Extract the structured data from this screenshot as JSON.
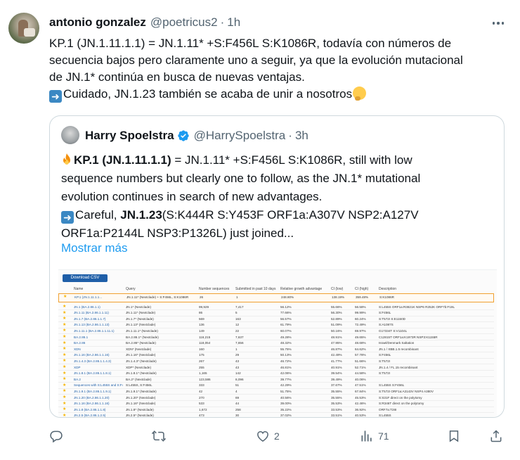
{
  "tweet": {
    "author_name": "antonio gonzalez",
    "author_handle": "@poetricus2",
    "time": "1h",
    "separator": "·",
    "lines": [
      "KP.1 (JN.1.11.1.1) = JN.1.11* +S:F456L S:K1086R, todavía con números de",
      "secuencia bajos pero claramente uno a seguir, ya que la evolución mutacional",
      "de JN.1* continúa en busca de nuevas ventajas."
    ],
    "line4": "Cuidado, JN.1.23 también se acaba de unir a nosotros",
    "emoji_arrow": "➡",
    "emoji_thinking": "🤔"
  },
  "quote": {
    "author_name": "Harry Spoelstra",
    "author_handle": "@HarrySpoelstra",
    "time": "3h",
    "separator": "·",
    "line1_bold": "KP.1 (JN.1.11.1.1)",
    "line1_rest": " = JN.1.11* +S:F456L S:K1086R, still with low",
    "line2": "sequence numbers but clearly one to follow, as the JN.1* mutational",
    "line3": "evolution continues in search of new advantages.",
    "line4_pre": "Careful, ",
    "line4_bold": "JN.1.23",
    "line4_rest": "(S:K444R S:Y453F ORF1a:A307V NSP2:A127V",
    "line5": "ORF1a:P2144L NSP3:P1326L) just joined...",
    "show_more": "Mostrar más",
    "emoji_arrow": "➡",
    "emoji_fire": "🔥"
  },
  "image": {
    "download_label": "Download CSV",
    "columns": [
      "Name",
      "Query",
      "Number sequences",
      "Submitted in past 10 days",
      "Relative growth advantage",
      "CI (low)",
      "CI (high)",
      "Description"
    ],
    "rows": [
      {
        "name": "KP.1 (JN.1.11.1.1...",
        "query": "JN.1.11* (Nextclade) + S:F456L, S:K1086R",
        "n": "26",
        "sub": "1",
        "rga": "248.80%",
        "lo": "138.19%",
        "hi": "359.48%",
        "desc": "S:K1086R",
        "hl": true
      },
      {
        "name": "JN.1 (BA.2.86.1.1)",
        "query": "JN.1* (Nextclade)",
        "n": "99,929",
        "sub": "7,417",
        "rga": "56.12%",
        "lo": "55.66%",
        "hi": "56.58%",
        "desc": "S:L455S ORF1a:R3821K NSP6 R252K ORF7b:F19L"
      },
      {
        "name": "JN.1.11 (BA.2.86.1.1.11)",
        "query": "JN.1.11* (Nextclade)",
        "n": "86",
        "sub": "5",
        "rga": "77.66%",
        "lo": "56.30%",
        "hi": "99.99%",
        "desc": "S:F456L"
      },
      {
        "name": "JN.1.7 (BA.2.86.1.1.7)",
        "query": "JN.1.7* (Nextclade)",
        "n": "569",
        "sub": "163",
        "rga": "56.57%",
        "lo": "52.89%",
        "hi": "60.24%",
        "desc": "S:T572I S:E1150D"
      },
      {
        "name": "JN.1.13 (BA.2.86.1.1.13)",
        "query": "JN.1.13* (Nextclade)",
        "n": "136",
        "sub": "12",
        "rga": "61.79%",
        "lo": "51.09%",
        "hi": "72.49%",
        "desc": "S:A1087S"
      },
      {
        "name": "JN.1.11.1 (BA.2.86.1.1.11.1)",
        "query": "JN.1.11.1* (Nextclade)",
        "n": "149",
        "sub": "22",
        "rga": "60.07%",
        "lo": "50.16%",
        "hi": "69.97%",
        "desc": "G17334T S:V1104L"
      },
      {
        "name": "BA.2.86.1",
        "query": "BA.2.86.1* (Nextclade)",
        "n": "116,215",
        "sub": "7,637",
        "rga": "49.28%",
        "lo": "48.91%",
        "hi": "49.65%",
        "desc": "C12815T ORF1a:K1973R NSP3:K1155R"
      },
      {
        "name": "BA.2.86",
        "query": "BA.2.86* (Nextclade)",
        "n": "118,054",
        "sub": "7,656",
        "rga": "48.32%",
        "lo": "47.95%",
        "hi": "48.68%",
        "desc": "Israel/Denmark Saltation"
      },
      {
        "name": "XDN",
        "query": "XDN* (Nextclade)",
        "n": "160",
        "sub": "1",
        "rga": "55.75%",
        "lo": "46.87%",
        "hi": "64.62%",
        "desc": "JN.1 / XBB.1.5 recombinant"
      },
      {
        "name": "JN.1.16 (BA.2.86.1.1.16)",
        "query": "JN.1.16* (Nextclade)",
        "n": "175",
        "sub": "29",
        "rga": "50.13%",
        "lo": "42.49%",
        "hi": "57.78%",
        "desc": "S:F456L"
      },
      {
        "name": "JN.1.4.3 (BA.2.86.1.1.4.3)",
        "query": "JN.1.4.3* (Nextclade)",
        "n": "267",
        "sub": "43",
        "rga": "46.72%",
        "lo": "41.77%",
        "hi": "51.66%",
        "desc": "S:T572I"
      },
      {
        "name": "XDP",
        "query": "XDP* (Nextclade)",
        "n": "255",
        "sub": "43",
        "rga": "46.81%",
        "lo": "40.91%",
        "hi": "52.71%",
        "desc": "JN.1.4 / FL.15 recombinant"
      },
      {
        "name": "JN.1.8.1 (BA.2.86.1.1.8.1)",
        "query": "JN.1.8.1* (Nextclade)",
        "n": "1,165",
        "sub": "142",
        "rga": "42.06%",
        "lo": "39.54%",
        "hi": "44.58%",
        "desc": "S:T572I"
      },
      {
        "name": "BA.2",
        "query": "BA.2* (Nextclade)",
        "n": "123,586",
        "sub": "8,096",
        "rga": "39.77%",
        "lo": "39.49%",
        "hi": "40.06%",
        "desc": ""
      },
      {
        "name": "Sequences with S:L455S and S:F456L",
        "query": "S:L455S, S:F456L",
        "n": "333",
        "sub": "51",
        "rga": "42.29%",
        "lo": "37.67%",
        "hi": "47.51%",
        "desc": "S:L455S S:F456L"
      },
      {
        "name": "JN.1.9.1 (BA.2.86.1.1.9.1)",
        "query": "JN.1.9.1* (Nextclade)",
        "n": "42",
        "sub": "4",
        "rga": "51.75%",
        "lo": "35.55%",
        "hi": "67.84%",
        "desc": "S:T572I ORF1a:A3143V NSP4 A380V"
      },
      {
        "name": "JN.1.20 (BA.2.86.1.1.20)",
        "query": "JN.1.20* (Nextclade)",
        "n": "270",
        "sub": "69",
        "rga": "40.56%",
        "lo": "35.55%",
        "hi": "45.53%",
        "desc": "S:S31F direct on the polytomy"
      },
      {
        "name": "JN.1.16 (BA.2.86.1.1.16)",
        "query": "JN.1.16* (Nextclade)",
        "n": "533",
        "sub": "44",
        "rga": "39.00%",
        "lo": "35.53%",
        "hi": "42.46%",
        "desc": "S:R346T direct on the polytomy"
      },
      {
        "name": "JN.1.8 (BA.2.86.1.1.8)",
        "query": "JN.1.8* (Nextclade)",
        "n": "1,672",
        "sub": "258",
        "rga": "35.22%",
        "lo": "33.53%",
        "hi": "36.92%",
        "desc": "ORF7a:T28I"
      },
      {
        "name": "JN.2.5 (BA.2.86.1.2.5)",
        "query": "JN.2.5* (Nextclade)",
        "n": "473",
        "sub": "30",
        "rga": "37.02%",
        "lo": "33.51%",
        "hi": "40.53%",
        "desc": "S:L455S"
      },
      {
        "name": "XDK",
        "query": "XDK* (Nextclade)",
        "n": "399",
        "sub": "62",
        "rga": "36.59%",
        "lo": "32.73%",
        "hi": "40.27%",
        "desc": "JN.1.1 / XBB recombinant"
      }
    ]
  },
  "actions": {
    "reply_count": "",
    "retweet_count": "",
    "like_count": "2",
    "views_count": "71"
  }
}
